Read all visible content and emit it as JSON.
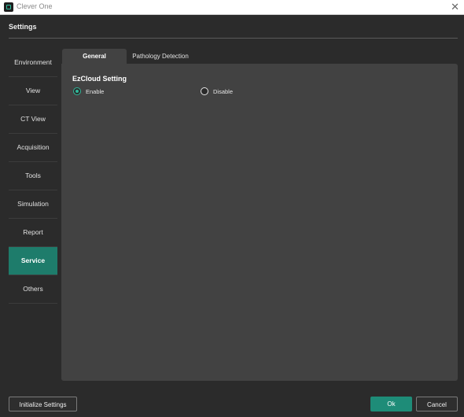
{
  "window": {
    "title": "Clever One",
    "close": "✕"
  },
  "settings": {
    "title": "Settings"
  },
  "sidebar": {
    "items": [
      {
        "label": "Environment"
      },
      {
        "label": "View"
      },
      {
        "label": "CT View"
      },
      {
        "label": "Acquisition"
      },
      {
        "label": "Tools"
      },
      {
        "label": "Simulation"
      },
      {
        "label": "Report"
      },
      {
        "label": "Service",
        "active": true
      },
      {
        "label": "Others"
      }
    ]
  },
  "tabs": [
    {
      "label": "General",
      "active": true
    },
    {
      "label": "Pathology Detection"
    }
  ],
  "ezcloud": {
    "title": "EzCloud Setting",
    "options": [
      {
        "label": "Enable",
        "selected": true
      },
      {
        "label": "Disable",
        "selected": false
      }
    ]
  },
  "footer": {
    "initialize_label": "Initialize Settings",
    "ok_label": "Ok",
    "cancel_label": "Cancel"
  },
  "colors": {
    "accent": "#1e7c6b",
    "ok_button": "#1e8c78",
    "radio": "#2fb89a"
  }
}
